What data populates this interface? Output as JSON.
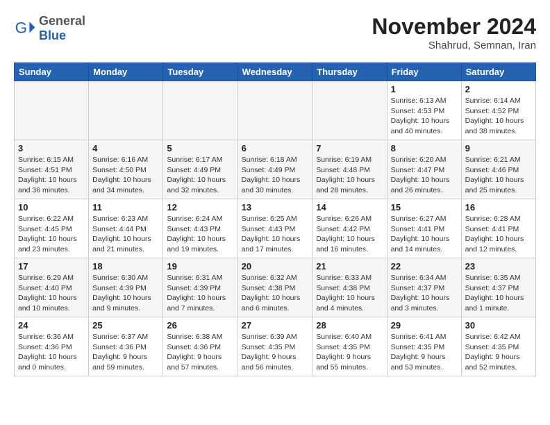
{
  "header": {
    "logo_general": "General",
    "logo_blue": "Blue",
    "month_title": "November 2024",
    "subtitle": "Shahrud, Semnan, Iran"
  },
  "calendar": {
    "days_of_week": [
      "Sunday",
      "Monday",
      "Tuesday",
      "Wednesday",
      "Thursday",
      "Friday",
      "Saturday"
    ],
    "weeks": [
      [
        {
          "day": "",
          "info": ""
        },
        {
          "day": "",
          "info": ""
        },
        {
          "day": "",
          "info": ""
        },
        {
          "day": "",
          "info": ""
        },
        {
          "day": "",
          "info": ""
        },
        {
          "day": "1",
          "info": "Sunrise: 6:13 AM\nSunset: 4:53 PM\nDaylight: 10 hours and 40 minutes."
        },
        {
          "day": "2",
          "info": "Sunrise: 6:14 AM\nSunset: 4:52 PM\nDaylight: 10 hours and 38 minutes."
        }
      ],
      [
        {
          "day": "3",
          "info": "Sunrise: 6:15 AM\nSunset: 4:51 PM\nDaylight: 10 hours and 36 minutes."
        },
        {
          "day": "4",
          "info": "Sunrise: 6:16 AM\nSunset: 4:50 PM\nDaylight: 10 hours and 34 minutes."
        },
        {
          "day": "5",
          "info": "Sunrise: 6:17 AM\nSunset: 4:49 PM\nDaylight: 10 hours and 32 minutes."
        },
        {
          "day": "6",
          "info": "Sunrise: 6:18 AM\nSunset: 4:49 PM\nDaylight: 10 hours and 30 minutes."
        },
        {
          "day": "7",
          "info": "Sunrise: 6:19 AM\nSunset: 4:48 PM\nDaylight: 10 hours and 28 minutes."
        },
        {
          "day": "8",
          "info": "Sunrise: 6:20 AM\nSunset: 4:47 PM\nDaylight: 10 hours and 26 minutes."
        },
        {
          "day": "9",
          "info": "Sunrise: 6:21 AM\nSunset: 4:46 PM\nDaylight: 10 hours and 25 minutes."
        }
      ],
      [
        {
          "day": "10",
          "info": "Sunrise: 6:22 AM\nSunset: 4:45 PM\nDaylight: 10 hours and 23 minutes."
        },
        {
          "day": "11",
          "info": "Sunrise: 6:23 AM\nSunset: 4:44 PM\nDaylight: 10 hours and 21 minutes."
        },
        {
          "day": "12",
          "info": "Sunrise: 6:24 AM\nSunset: 4:43 PM\nDaylight: 10 hours and 19 minutes."
        },
        {
          "day": "13",
          "info": "Sunrise: 6:25 AM\nSunset: 4:43 PM\nDaylight: 10 hours and 17 minutes."
        },
        {
          "day": "14",
          "info": "Sunrise: 6:26 AM\nSunset: 4:42 PM\nDaylight: 10 hours and 16 minutes."
        },
        {
          "day": "15",
          "info": "Sunrise: 6:27 AM\nSunset: 4:41 PM\nDaylight: 10 hours and 14 minutes."
        },
        {
          "day": "16",
          "info": "Sunrise: 6:28 AM\nSunset: 4:41 PM\nDaylight: 10 hours and 12 minutes."
        }
      ],
      [
        {
          "day": "17",
          "info": "Sunrise: 6:29 AM\nSunset: 4:40 PM\nDaylight: 10 hours and 10 minutes."
        },
        {
          "day": "18",
          "info": "Sunrise: 6:30 AM\nSunset: 4:39 PM\nDaylight: 10 hours and 9 minutes."
        },
        {
          "day": "19",
          "info": "Sunrise: 6:31 AM\nSunset: 4:39 PM\nDaylight: 10 hours and 7 minutes."
        },
        {
          "day": "20",
          "info": "Sunrise: 6:32 AM\nSunset: 4:38 PM\nDaylight: 10 hours and 6 minutes."
        },
        {
          "day": "21",
          "info": "Sunrise: 6:33 AM\nSunset: 4:38 PM\nDaylight: 10 hours and 4 minutes."
        },
        {
          "day": "22",
          "info": "Sunrise: 6:34 AM\nSunset: 4:37 PM\nDaylight: 10 hours and 3 minutes."
        },
        {
          "day": "23",
          "info": "Sunrise: 6:35 AM\nSunset: 4:37 PM\nDaylight: 10 hours and 1 minute."
        }
      ],
      [
        {
          "day": "24",
          "info": "Sunrise: 6:36 AM\nSunset: 4:36 PM\nDaylight: 10 hours and 0 minutes."
        },
        {
          "day": "25",
          "info": "Sunrise: 6:37 AM\nSunset: 4:36 PM\nDaylight: 9 hours and 59 minutes."
        },
        {
          "day": "26",
          "info": "Sunrise: 6:38 AM\nSunset: 4:36 PM\nDaylight: 9 hours and 57 minutes."
        },
        {
          "day": "27",
          "info": "Sunrise: 6:39 AM\nSunset: 4:35 PM\nDaylight: 9 hours and 56 minutes."
        },
        {
          "day": "28",
          "info": "Sunrise: 6:40 AM\nSunset: 4:35 PM\nDaylight: 9 hours and 55 minutes."
        },
        {
          "day": "29",
          "info": "Sunrise: 6:41 AM\nSunset: 4:35 PM\nDaylight: 9 hours and 53 minutes."
        },
        {
          "day": "30",
          "info": "Sunrise: 6:42 AM\nSunset: 4:35 PM\nDaylight: 9 hours and 52 minutes."
        }
      ]
    ]
  }
}
